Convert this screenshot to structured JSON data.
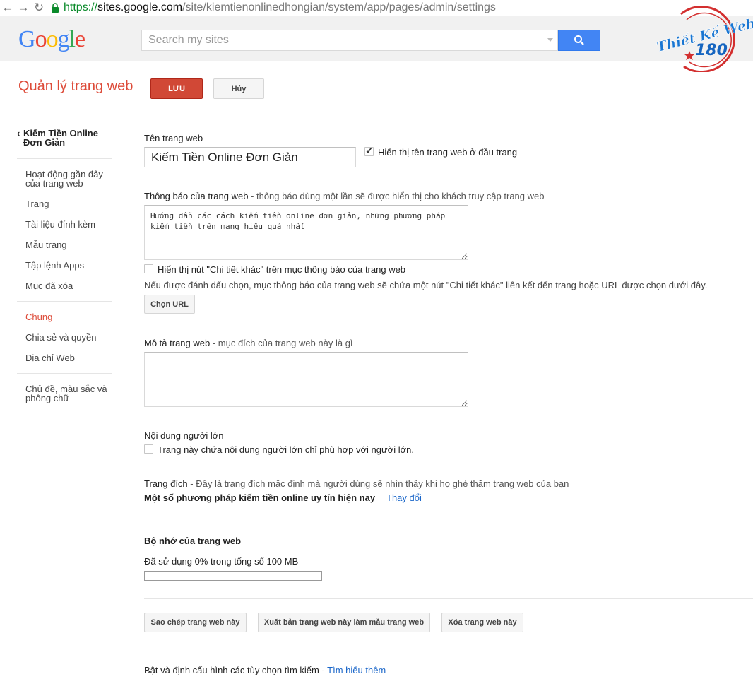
{
  "browser": {
    "url_scheme": "https://",
    "url_host": "sites.google.com",
    "url_path": "/site/kiemtienonlinedhongian/system/app/pages/admin/settings"
  },
  "header": {
    "logo": "Google",
    "search_placeholder": "Search my sites"
  },
  "badge": {
    "text": "Thiết Kế Website",
    "number": "180"
  },
  "page": {
    "title": "Quản lý trang web",
    "save_label": "LƯU",
    "cancel_label": "Hủy"
  },
  "sidebar": {
    "site_name": "Kiếm Tiền Online Đơn Giản",
    "items": [
      {
        "label": "Hoạt động gần đây của trang web"
      },
      {
        "label": "Trang"
      },
      {
        "label": "Tài liệu đính kèm"
      },
      {
        "label": "Mẫu trang"
      },
      {
        "label": "Tập lệnh Apps"
      },
      {
        "label": "Mục đã xóa"
      },
      {
        "label": "Chung"
      },
      {
        "label": "Chia sẻ và quyền"
      },
      {
        "label": "Địa chỉ Web"
      },
      {
        "label": "Chủ đề, màu sắc và phông chữ"
      }
    ]
  },
  "settings": {
    "site_name_label": "Tên trang web",
    "site_name_value": "Kiếm Tiền Online Đơn Giản",
    "show_name_label": "Hiển thị tên trang web ở đầu trang",
    "show_name_checked": true,
    "notice_label": "Thông báo của trang web",
    "notice_hint": " - thông báo dùng một lần sẽ được hiển thị cho khách truy cập trang web",
    "notice_value": "Hướng dẫn các cách kiếm tiền online đơn giản, những phương pháp kiếm tiền trên mạng hiệu quả nhất",
    "more_button_label": "Hiển thị nút \"Chi tiết khác\" trên mục thông báo của trang web",
    "more_button_checked": false,
    "more_button_desc": "Nếu được đánh dấu chọn, mục thông báo của trang web sẽ chứa một nút \"Chi tiết khác\" liên kết đến trang hoặc URL được chọn dưới đây.",
    "choose_url_label": "Chọn URL",
    "description_label": "Mô tả trang web",
    "description_hint": " - mục đích của trang web này là gì",
    "description_value": "",
    "adult_label": "Nội dung người lớn",
    "adult_checkbox_label": "Trang này chứa nội dung người lớn chỉ phù hợp với người lớn.",
    "adult_checked": false,
    "landing_label": "Trang đích",
    "landing_hint": " - Đây là trang đích mặc định mà người dùng sẽ nhìn thấy khi họ ghé thăm trang web của bạn",
    "landing_page": "Một số phương pháp kiếm tiền online uy tín hiện nay",
    "landing_change": "Thay đổi",
    "storage_label": "Bộ nhớ của trang web",
    "storage_usage": "Đã sử dụng 0% trong tổng số 100 MB",
    "storage_used_percent": 0,
    "copy_label": "Sao chép trang web này",
    "publish_template_label": "Xuất bản trang web này làm mẫu trang web",
    "delete_label": "Xóa trang web này",
    "search_options_text": "Bật và định cấu hình các tùy chọn tìm kiếm - ",
    "learn_more": "Tìm hiểu thêm"
  }
}
